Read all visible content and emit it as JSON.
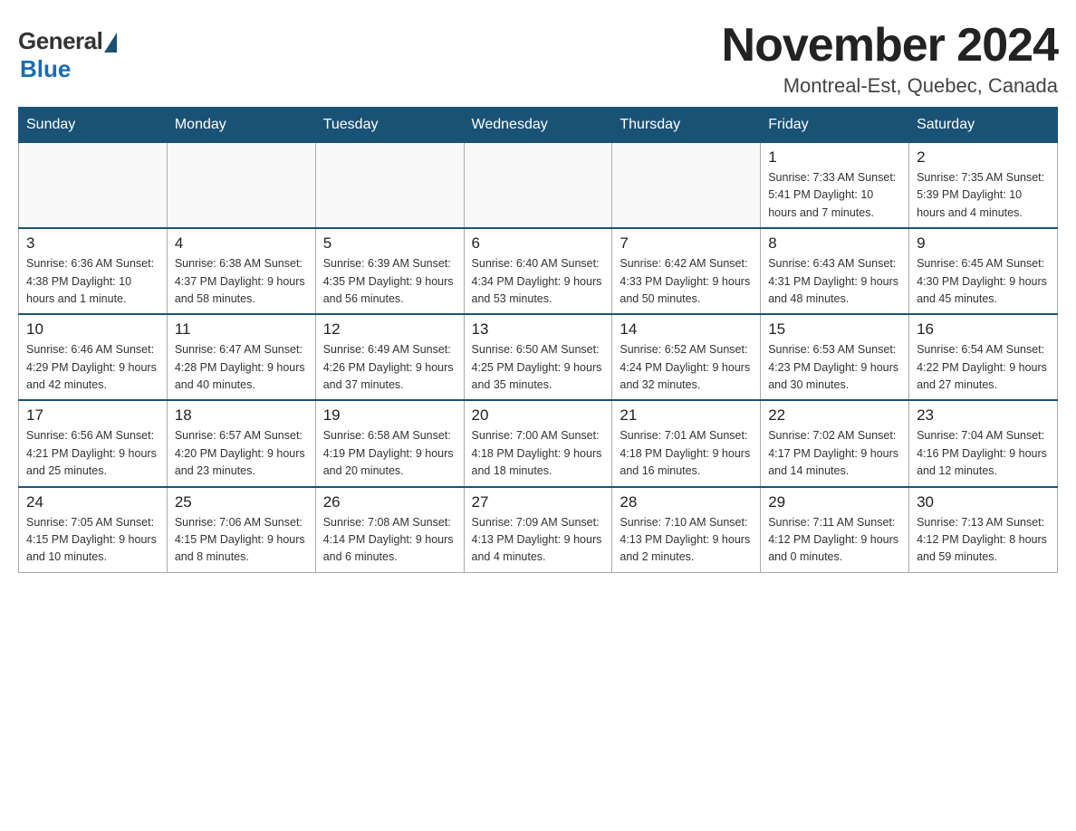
{
  "header": {
    "logo": {
      "general": "General",
      "blue": "Blue"
    },
    "title": "November 2024",
    "location": "Montreal-Est, Quebec, Canada"
  },
  "days_of_week": [
    "Sunday",
    "Monday",
    "Tuesday",
    "Wednesday",
    "Thursday",
    "Friday",
    "Saturday"
  ],
  "weeks": [
    [
      {
        "day": "",
        "info": ""
      },
      {
        "day": "",
        "info": ""
      },
      {
        "day": "",
        "info": ""
      },
      {
        "day": "",
        "info": ""
      },
      {
        "day": "",
        "info": ""
      },
      {
        "day": "1",
        "info": "Sunrise: 7:33 AM\nSunset: 5:41 PM\nDaylight: 10 hours and 7 minutes."
      },
      {
        "day": "2",
        "info": "Sunrise: 7:35 AM\nSunset: 5:39 PM\nDaylight: 10 hours and 4 minutes."
      }
    ],
    [
      {
        "day": "3",
        "info": "Sunrise: 6:36 AM\nSunset: 4:38 PM\nDaylight: 10 hours and 1 minute."
      },
      {
        "day": "4",
        "info": "Sunrise: 6:38 AM\nSunset: 4:37 PM\nDaylight: 9 hours and 58 minutes."
      },
      {
        "day": "5",
        "info": "Sunrise: 6:39 AM\nSunset: 4:35 PM\nDaylight: 9 hours and 56 minutes."
      },
      {
        "day": "6",
        "info": "Sunrise: 6:40 AM\nSunset: 4:34 PM\nDaylight: 9 hours and 53 minutes."
      },
      {
        "day": "7",
        "info": "Sunrise: 6:42 AM\nSunset: 4:33 PM\nDaylight: 9 hours and 50 minutes."
      },
      {
        "day": "8",
        "info": "Sunrise: 6:43 AM\nSunset: 4:31 PM\nDaylight: 9 hours and 48 minutes."
      },
      {
        "day": "9",
        "info": "Sunrise: 6:45 AM\nSunset: 4:30 PM\nDaylight: 9 hours and 45 minutes."
      }
    ],
    [
      {
        "day": "10",
        "info": "Sunrise: 6:46 AM\nSunset: 4:29 PM\nDaylight: 9 hours and 42 minutes."
      },
      {
        "day": "11",
        "info": "Sunrise: 6:47 AM\nSunset: 4:28 PM\nDaylight: 9 hours and 40 minutes."
      },
      {
        "day": "12",
        "info": "Sunrise: 6:49 AM\nSunset: 4:26 PM\nDaylight: 9 hours and 37 minutes."
      },
      {
        "day": "13",
        "info": "Sunrise: 6:50 AM\nSunset: 4:25 PM\nDaylight: 9 hours and 35 minutes."
      },
      {
        "day": "14",
        "info": "Sunrise: 6:52 AM\nSunset: 4:24 PM\nDaylight: 9 hours and 32 minutes."
      },
      {
        "day": "15",
        "info": "Sunrise: 6:53 AM\nSunset: 4:23 PM\nDaylight: 9 hours and 30 minutes."
      },
      {
        "day": "16",
        "info": "Sunrise: 6:54 AM\nSunset: 4:22 PM\nDaylight: 9 hours and 27 minutes."
      }
    ],
    [
      {
        "day": "17",
        "info": "Sunrise: 6:56 AM\nSunset: 4:21 PM\nDaylight: 9 hours and 25 minutes."
      },
      {
        "day": "18",
        "info": "Sunrise: 6:57 AM\nSunset: 4:20 PM\nDaylight: 9 hours and 23 minutes."
      },
      {
        "day": "19",
        "info": "Sunrise: 6:58 AM\nSunset: 4:19 PM\nDaylight: 9 hours and 20 minutes."
      },
      {
        "day": "20",
        "info": "Sunrise: 7:00 AM\nSunset: 4:18 PM\nDaylight: 9 hours and 18 minutes."
      },
      {
        "day": "21",
        "info": "Sunrise: 7:01 AM\nSunset: 4:18 PM\nDaylight: 9 hours and 16 minutes."
      },
      {
        "day": "22",
        "info": "Sunrise: 7:02 AM\nSunset: 4:17 PM\nDaylight: 9 hours and 14 minutes."
      },
      {
        "day": "23",
        "info": "Sunrise: 7:04 AM\nSunset: 4:16 PM\nDaylight: 9 hours and 12 minutes."
      }
    ],
    [
      {
        "day": "24",
        "info": "Sunrise: 7:05 AM\nSunset: 4:15 PM\nDaylight: 9 hours and 10 minutes."
      },
      {
        "day": "25",
        "info": "Sunrise: 7:06 AM\nSunset: 4:15 PM\nDaylight: 9 hours and 8 minutes."
      },
      {
        "day": "26",
        "info": "Sunrise: 7:08 AM\nSunset: 4:14 PM\nDaylight: 9 hours and 6 minutes."
      },
      {
        "day": "27",
        "info": "Sunrise: 7:09 AM\nSunset: 4:13 PM\nDaylight: 9 hours and 4 minutes."
      },
      {
        "day": "28",
        "info": "Sunrise: 7:10 AM\nSunset: 4:13 PM\nDaylight: 9 hours and 2 minutes."
      },
      {
        "day": "29",
        "info": "Sunrise: 7:11 AM\nSunset: 4:12 PM\nDaylight: 9 hours and 0 minutes."
      },
      {
        "day": "30",
        "info": "Sunrise: 7:13 AM\nSunset: 4:12 PM\nDaylight: 8 hours and 59 minutes."
      }
    ]
  ]
}
